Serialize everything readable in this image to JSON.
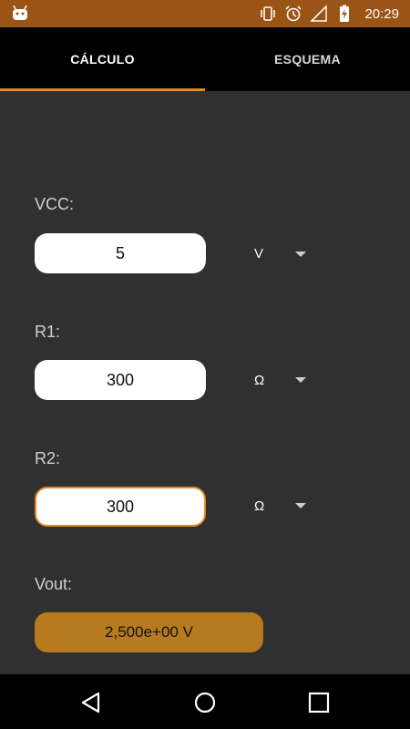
{
  "status": {
    "time": "20:29",
    "icons": [
      "android-icon",
      "vibrate-icon",
      "alarm-icon",
      "signal-icon",
      "battery-charging-icon"
    ]
  },
  "tabs": [
    {
      "label": "CÁLCULO",
      "active": true
    },
    {
      "label": "ESQUEMA",
      "active": false
    }
  ],
  "vcc": {
    "label": "VCC:",
    "value": "5",
    "unit": "V"
  },
  "r1": {
    "label": "R1:",
    "value": "300",
    "unit": "Ω"
  },
  "r2": {
    "label": "R2:",
    "value": "300",
    "unit": "Ω"
  },
  "vout": {
    "label": "Vout:",
    "value": "2,500e+00 V"
  },
  "colors": {
    "status_bar": "#9a5415",
    "accent": "#e08a2a",
    "result_bg": "#b77a1e",
    "background": "#303030"
  },
  "navigation": [
    "back-icon",
    "home-icon",
    "recents-icon"
  ]
}
